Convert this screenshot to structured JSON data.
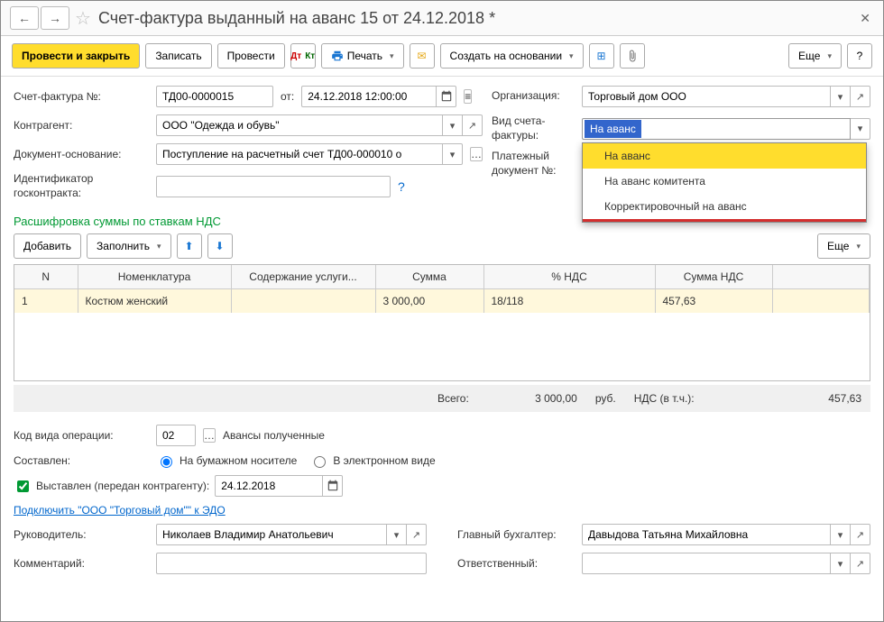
{
  "title": "Счет-фактура выданный на аванс 15 от 24.12.2018 *",
  "toolbar": {
    "post_close": "Провести и закрыть",
    "write": "Записать",
    "post": "Провести",
    "print": "Печать",
    "create_based": "Создать на основании",
    "more": "Еще"
  },
  "header": {
    "number_label": "Счет-фактура №:",
    "number": "ТД00-0000015",
    "from_label": "от:",
    "date": "24.12.2018 12:00:00",
    "org_label": "Организация:",
    "org": "Торговый дом ООО",
    "counterparty_label": "Контрагент:",
    "counterparty": "ООО \"Одежда и обувь\"",
    "invoice_type_label": "Вид счета-фактуры:",
    "invoice_type_sel": "На аванс",
    "basis_label": "Документ-основание:",
    "basis": "Поступление на расчетный счет ТД00-000010 о",
    "payment_label": "Платежный документ №:",
    "govid_label": "Идентификатор госконтракта:"
  },
  "dropdown": {
    "items": [
      "На аванс",
      "На аванс комитента",
      "Корректировочный на аванс"
    ]
  },
  "vat_section": {
    "title": "Расшифровка суммы по ставкам НДС",
    "add": "Добавить",
    "fill": "Заполнить",
    "more": "Еще",
    "columns": {
      "n": "N",
      "nom": "Номенклатура",
      "content": "Содержание услуги...",
      "sum": "Сумма",
      "rate": "% НДС",
      "vat_sum": "Сумма НДС"
    },
    "rows": [
      {
        "n": "1",
        "nom": "Костюм женский",
        "content": "",
        "sum": "3 000,00",
        "rate": "18/118",
        "vat_sum": "457,63"
      }
    ]
  },
  "totals": {
    "total_label": "Всего:",
    "total": "3 000,00",
    "currency": "руб.",
    "vat_label": "НДС (в т.ч.):",
    "vat": "457,63"
  },
  "footer": {
    "op_code_label": "Код вида операции:",
    "op_code": "02",
    "op_code_desc": "Авансы полученные",
    "issued_label": "Составлен:",
    "paper": "На бумажном носителе",
    "electronic": "В электронном виде",
    "passed_label": "Выставлен (передан контрагенту):",
    "passed_date": "24.12.2018",
    "edo_link": "Подключить \"ООО \"Торговый дом\"\" к ЭДО",
    "director_label": "Руководитель:",
    "director": "Николаев Владимир Анатольевич",
    "accountant_label": "Главный бухгалтер:",
    "accountant": "Давыдова Татьяна Михайловна",
    "comment_label": "Комментарий:",
    "responsible_label": "Ответственный:"
  }
}
